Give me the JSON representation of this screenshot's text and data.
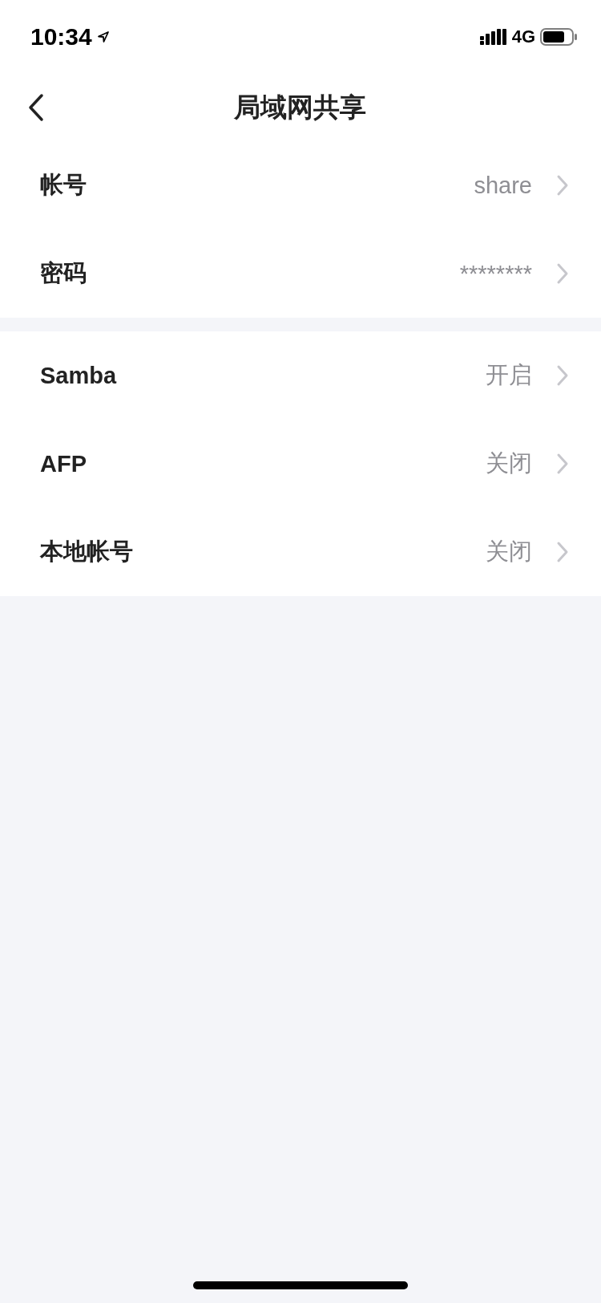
{
  "status_bar": {
    "time": "10:34",
    "network": "4G"
  },
  "nav": {
    "title": "局域网共享"
  },
  "groups": [
    {
      "rows": [
        {
          "label": "帐号",
          "value": "share"
        },
        {
          "label": "密码",
          "value": "********"
        }
      ]
    },
    {
      "rows": [
        {
          "label": "Samba",
          "value": "开启"
        },
        {
          "label": "AFP",
          "value": "关闭"
        },
        {
          "label": "本地帐号",
          "value": "关闭"
        }
      ]
    }
  ]
}
